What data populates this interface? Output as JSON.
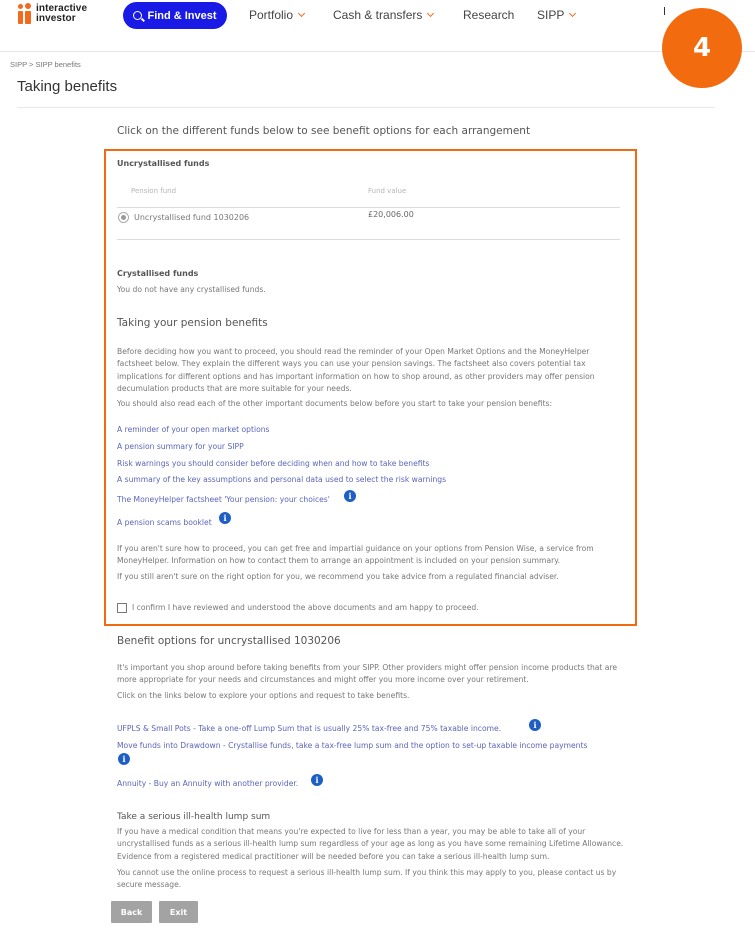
{
  "header": {
    "logo_line1": "interactive",
    "logo_line2": "investor",
    "find_invest_label": "Find & Invest",
    "nav": [
      {
        "label": "Portfolio",
        "has_dropdown": true
      },
      {
        "label": "Cash & transfers",
        "has_dropdown": true
      },
      {
        "label": "Research",
        "has_dropdown": false
      },
      {
        "label": "SIPP",
        "has_dropdown": true
      }
    ]
  },
  "step_badge": "4",
  "breadcrumb": "SIPP > SIPP benefits",
  "page_title": "Taking benefits",
  "intro": "Click on the different funds below to see benefit options for each arrangement",
  "uncrystallised": {
    "heading": "Uncrystallised funds",
    "col_fund": "Pension fund",
    "col_value": "Fund value",
    "rows": [
      {
        "name": "Uncrystallised fund 1030206",
        "value": "£20,006.00",
        "selected": true
      }
    ]
  },
  "crystallised": {
    "heading": "Crystallised funds",
    "text": "You do not have any crystallised funds."
  },
  "taking_benefits": {
    "heading": "Taking your pension benefits",
    "para1": "Before deciding how you want to proceed, you should read the reminder of your Open Market Options and the MoneyHelper factsheet below. They explain the different ways you can use your pension savings. The factsheet also covers potential tax implications for different options and has important information on how to shop around, as other providers may offer pension decumulation products that are more suitable for your needs.",
    "para2": "You should also read each of the other important documents below before you start to take your pension benefits:",
    "links": [
      {
        "label": "A reminder of your open market options",
        "info": false
      },
      {
        "label": "A pension summary for your SIPP",
        "info": false
      },
      {
        "label": "Risk warnings you should consider before deciding when and how to take benefits",
        "info": false
      },
      {
        "label": "A summary of the key assumptions and personal data used to select the risk warnings",
        "info": false
      },
      {
        "label": "The MoneyHelper factsheet 'Your pension: your choices'",
        "info": true
      },
      {
        "label": "A pension scams booklet",
        "info": true
      }
    ],
    "para3": "If you aren't sure how to proceed, you can get free and impartial guidance on your options from Pension Wise, a service from MoneyHelper. Information on how to contact them to arrange an appointment is included on your pension summary.",
    "para4": "If you still aren't sure on the right option for you, we recommend you take advice from a regulated financial adviser.",
    "confirm_label": "I confirm I have reviewed and understood the above documents and am happy to proceed.",
    "confirm_checked": false
  },
  "benefit_options": {
    "heading": "Benefit options for uncrystallised 1030206",
    "para1": "It's important you shop around before taking benefits from your SIPP. Other providers might offer pension income products that are more appropriate for your needs and circumstances and might offer you more income over your retirement.",
    "para2": "Click on the links below to explore your options and request to take benefits.",
    "options": [
      {
        "label": "UFPLS & Small Pots - Take a one-off Lump Sum that is usually 25% tax-free and 75% taxable income."
      },
      {
        "label": "Move funds into Drawdown - Crystallise funds, take a tax-free lump sum and the option to set-up taxable income payments"
      },
      {
        "label": "Annuity - Buy an Annuity with another provider."
      }
    ]
  },
  "ill_health": {
    "heading": "Take a serious ill-health lump sum",
    "para1": "If you have a medical condition that means you're expected to live for less than a year, you may be able to take all of your uncrystallised funds as a serious ill-health lump sum regardless of your age as long as you have some remaining Lifetime Allowance. Evidence from a registered medical practitioner will be needed before you can take a serious ill-health lump sum.",
    "para2": "You cannot use the online process to request a serious ill-health lump sum. If you think this may apply to you, please contact us by secure message."
  },
  "buttons": {
    "back": "Back",
    "exit": "Exit"
  },
  "icons": {
    "info": "i"
  },
  "colors": {
    "accent_orange": "#f06a14",
    "brand_blue": "#1a1ae6",
    "link": "#5a66b8",
    "info_icon": "#1f5fc4",
    "button_grey": "#a3a3a3"
  }
}
